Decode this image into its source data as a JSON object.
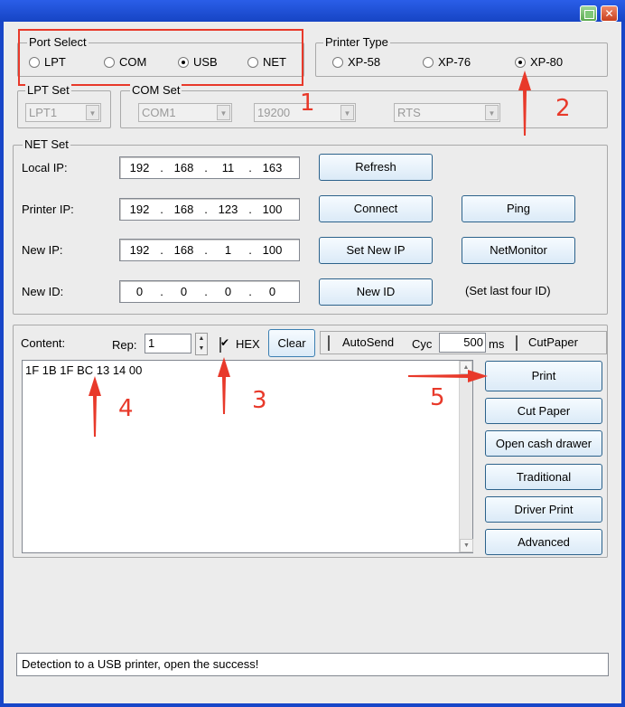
{
  "port_select": {
    "title": "Port Select",
    "options": [
      {
        "label": "LPT",
        "selected": false
      },
      {
        "label": "COM",
        "selected": false
      },
      {
        "label": "USB",
        "selected": true
      },
      {
        "label": "NET",
        "selected": false
      }
    ]
  },
  "printer_type": {
    "title": "Printer Type",
    "options": [
      {
        "label": "XP-58",
        "selected": false
      },
      {
        "label": "XP-76",
        "selected": false
      },
      {
        "label": "XP-80",
        "selected": true
      }
    ]
  },
  "lpt_set": {
    "title": "LPT Set",
    "port": "LPT1"
  },
  "com_set": {
    "title": "COM Set",
    "port": "COM1",
    "baud": "19200",
    "flow": "RTS"
  },
  "net_set": {
    "title": "NET Set",
    "local_ip": {
      "label": "Local IP:",
      "octets": [
        "192",
        "168",
        "11",
        "163"
      ]
    },
    "printer_ip": {
      "label": "Printer IP:",
      "octets": [
        "192",
        "168",
        "123",
        "100"
      ]
    },
    "new_ip": {
      "label": "New IP:",
      "octets": [
        "192",
        "168",
        "1",
        "100"
      ]
    },
    "new_id": {
      "label": "New ID:",
      "octets": [
        "0",
        "0",
        "0",
        "0"
      ]
    },
    "refresh_label": "Refresh",
    "connect_label": "Connect",
    "set_new_ip_label": "Set New IP",
    "new_id_label": "New ID",
    "ping_label": "Ping",
    "netmonitor_label": "NetMonitor",
    "hint": "(Set last four ID)"
  },
  "content": {
    "label": "Content:",
    "rep_label": "Rep:",
    "rep_value": "1",
    "hex_label": "HEX",
    "hex_checked": true,
    "clear_label": "Clear",
    "autosend_label": "AutoSend",
    "autosend_checked": false,
    "cyc_label": "Cyc",
    "cyc_value": "500",
    "ms_label": "ms",
    "cutpaper_label": "CutPaper",
    "cutpaper_checked": false,
    "text": "1F 1B 1F BC 13 14 00"
  },
  "actions": {
    "print": "Print",
    "cut_paper": "Cut Paper",
    "open_cash_drawer": "Open cash drawer",
    "traditional": "Traditional",
    "driver_print": "Driver Print",
    "advanced": "Advanced"
  },
  "status": "Detection to a USB printer, open the success!",
  "annotations": [
    "1",
    "2",
    "3",
    "4",
    "5"
  ],
  "colors": {
    "annotation": "#e8392a",
    "titlebar": "#1846c8",
    "window": "#ececec"
  },
  "icons": {
    "minimize": "minimize-icon",
    "close": "close-icon"
  }
}
